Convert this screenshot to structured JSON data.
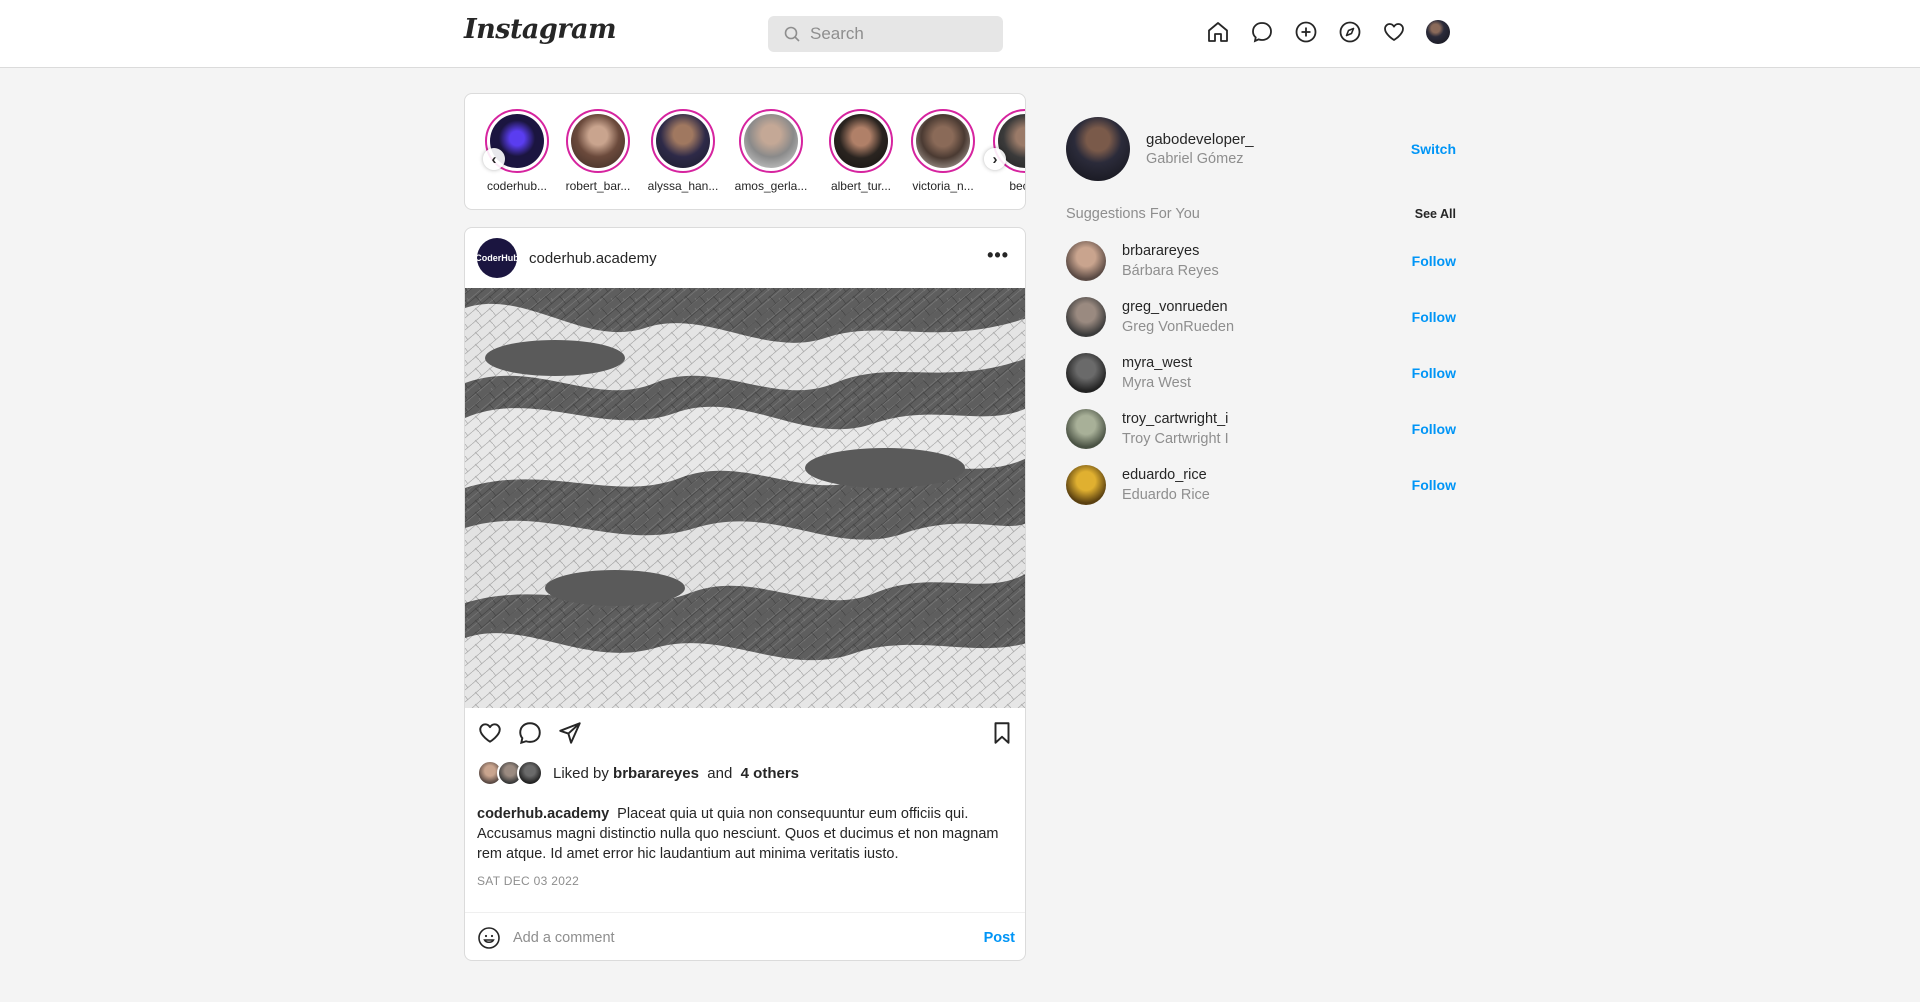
{
  "header": {
    "logo": "Instagram",
    "search_placeholder": "Search",
    "icons": [
      "home-icon",
      "messenger-icon",
      "new-post-icon",
      "explore-icon",
      "activity-icon",
      "profile-avatar"
    ]
  },
  "stories": [
    {
      "name": "coderhub..."
    },
    {
      "name": "robert_bar..."
    },
    {
      "name": "alyssa_han..."
    },
    {
      "name": "amos_gerla..."
    },
    {
      "name": "albert_tur..."
    },
    {
      "name": "victoria_n..."
    },
    {
      "name": "becky"
    }
  ],
  "post": {
    "username": "coderhub.academy",
    "avatar_text": "CoderHub",
    "liked_by_prefix": "Liked by",
    "liked_by_user": "brbarareyes",
    "liked_by_and": "and",
    "liked_by_others": "4 others",
    "caption_user": "coderhub.academy",
    "caption_text": "Placeat quia ut quia non consequuntur eum officiis qui. Accusamus magni distinctio nulla quo nesciunt. Quos et ducimus et non magnam rem atque. Id amet error hic laudantium aut minima veritatis iusto.",
    "date": "SAT DEC 03 2022",
    "comment_placeholder": "Add a comment",
    "post_label": "Post"
  },
  "sidebar": {
    "username": "gabodeveloper_",
    "full_name": "Gabriel Gómez",
    "switch_label": "Switch",
    "suggestions_title": "Suggestions For You",
    "see_all_label": "See All",
    "suggestions": [
      {
        "username": "brbarareyes",
        "name": "Bárbara Reyes",
        "follow": "Follow"
      },
      {
        "username": "greg_vonrueden",
        "name": "Greg VonRueden",
        "follow": "Follow"
      },
      {
        "username": "myra_west",
        "name": "Myra West",
        "follow": "Follow"
      },
      {
        "username": "troy_cartwright_i",
        "name": "Troy Cartwright I",
        "follow": "Follow"
      },
      {
        "username": "eduardo_rice",
        "name": "Eduardo Rice",
        "follow": "Follow"
      }
    ]
  },
  "colors": {
    "accent": "#0095f6",
    "story_ring": "#d6249f",
    "background": "#f4f4f4"
  }
}
